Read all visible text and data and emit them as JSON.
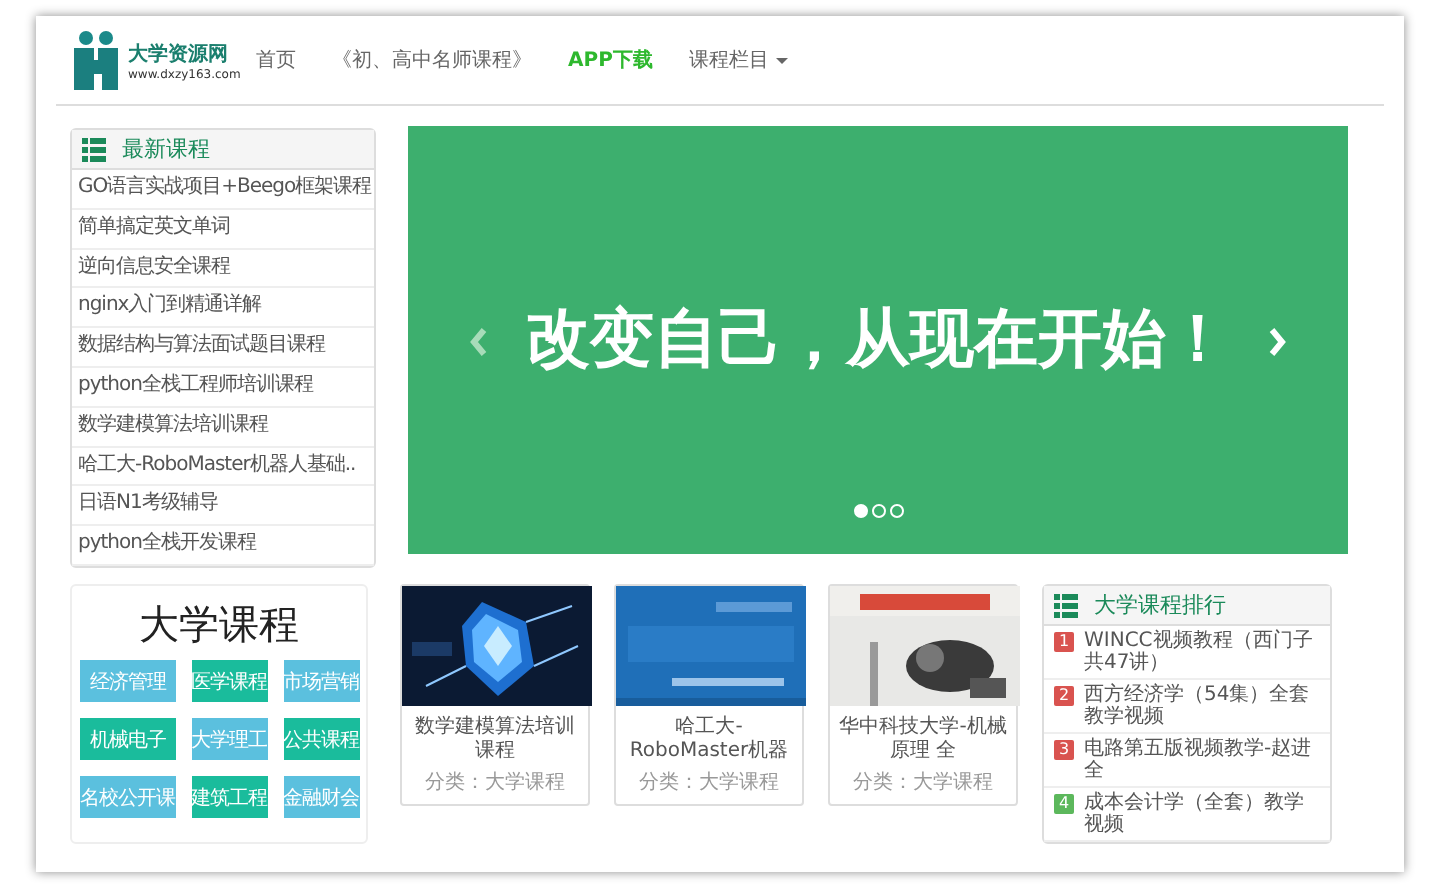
{
  "header": {
    "logo": {
      "name": "大学资源网",
      "url": "www.dxzy163.com"
    },
    "nav": [
      {
        "label": "首页",
        "kind": "link"
      },
      {
        "label": "《初、高中名师课程》",
        "kind": "link"
      },
      {
        "label": "APP下载",
        "kind": "highlight"
      },
      {
        "label": "课程栏目",
        "kind": "dropdown"
      }
    ]
  },
  "latest_courses": {
    "title": "最新课程",
    "items": [
      "GO语言实战项目+Beego框架课程",
      "简单搞定英文单词",
      "逆向信息安全课程",
      "nginx入门到精通详解",
      "数据结构与算法面试题目课程",
      "python全栈工程师培训课程",
      "数学建模算法培训课程",
      "哈工大-RoboMaster机器人基础..",
      "日语N1考级辅导",
      "python全栈开发课程"
    ]
  },
  "carousel": {
    "headline": "改变自己，从现在开始！",
    "indicators": [
      {
        "selected": true
      },
      {
        "selected": false
      },
      {
        "selected": false
      }
    ]
  },
  "categories": {
    "title": "大学课程",
    "items": [
      {
        "label": "经济管理",
        "color": "#5bc0de"
      },
      {
        "label": "医学课程",
        "color": "#1abc9c"
      },
      {
        "label": "市场营销",
        "color": "#5bc0de"
      },
      {
        "label": "机械电子",
        "color": "#1abc9c"
      },
      {
        "label": "大学理工",
        "color": "#5bc0de"
      },
      {
        "label": "公共课程",
        "color": "#1abc9c"
      },
      {
        "label": "名校公开课",
        "color": "#5bc0de"
      },
      {
        "label": "建筑工程",
        "color": "#1abc9c"
      },
      {
        "label": "金融财会",
        "color": "#5bc0de"
      }
    ]
  },
  "courses": [
    {
      "title": "数学建模算法培训课程",
      "category": "分类：大学课程"
    },
    {
      "title": "哈工大-RoboMaster机器",
      "category": "分类：大学课程"
    },
    {
      "title": "华中科技大学-机械原理 全",
      "category": "分类：大学课程"
    }
  ],
  "ranking": {
    "title": "大学课程排行",
    "items": [
      {
        "rank": "1",
        "title": "WINCC视频教程（西门子共47讲）",
        "color": "#d9534f"
      },
      {
        "rank": "2",
        "title": "西方经济学（54集）全套教学视频",
        "color": "#d9534f"
      },
      {
        "rank": "3",
        "title": "电路第五版视频教学-赵进全",
        "color": "#d9534f"
      },
      {
        "rank": "4",
        "title": "成本会计学（全套）教学视频",
        "color": "#5cb85c"
      }
    ]
  }
}
